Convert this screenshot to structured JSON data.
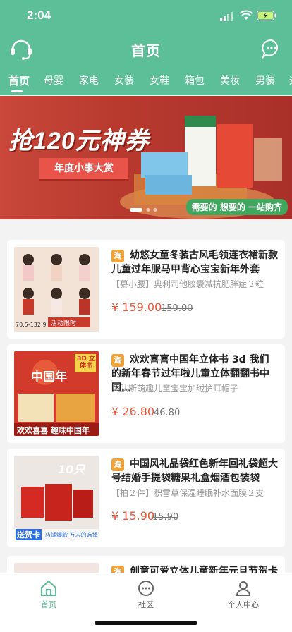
{
  "status": {
    "time": "2:04"
  },
  "header": {
    "title": "首页"
  },
  "tabs": [
    "首页",
    "母婴",
    "家电",
    "女装",
    "女鞋",
    "箱包",
    "美妆",
    "男装",
    "运"
  ],
  "banner": {
    "headline": "抢120元神券",
    "ribbon": "年度小事大赏",
    "badge": "需要的 想要的 一站购齐"
  },
  "products": [
    {
      "title": "幼悠女童冬装古风毛领连衣裙新款儿童过年服马甲背心宝宝新年外套",
      "subtitle": "【慕小腰】奥利司他胶囊减抗肥胖症３粒",
      "price": "¥ 159.00",
      "old_price": "159.00",
      "thumb_text": "活动限时",
      "thumb_size": "70.5-132.9"
    },
    {
      "title": "欢欢喜喜中国年立体书 3d 我们的新年春节过年啦儿童立体翻翻书中国…",
      "subtitle": "贝肽斯萌趣儿童宝宝加绒护耳帽子",
      "price": "¥ 26.80",
      "old_price": "46.80",
      "thumb_text": "欢欢喜喜 趣味中国年",
      "thumb_title": "中国年",
      "thumb_badge": "3D 立体书"
    },
    {
      "title": "中国风礼品袋红色新年回礼袋超大号结婚手提袋糖果礼盒烟酒包装袋",
      "subtitle": "【拍２件】积雪草保湿睡眠补水面膜２支",
      "price": "¥ 15.90",
      "old_price": "15.90",
      "thumb_text": "送贺卡",
      "thumb_count": "10只",
      "thumb_note": "店铺爆款 万人的选择"
    },
    {
      "title": "创意可爱立体儿童新年元旦节贺卡",
      "subtitle": "",
      "price": "",
      "old_price": ""
    }
  ],
  "tabbar": [
    {
      "label": "首页",
      "icon": "home-icon"
    },
    {
      "label": "社区",
      "icon": "community-icon"
    },
    {
      "label": "个人中心",
      "icon": "user-icon"
    }
  ],
  "colors": {
    "brand": "#5dbf97",
    "price": "#e8553a"
  }
}
